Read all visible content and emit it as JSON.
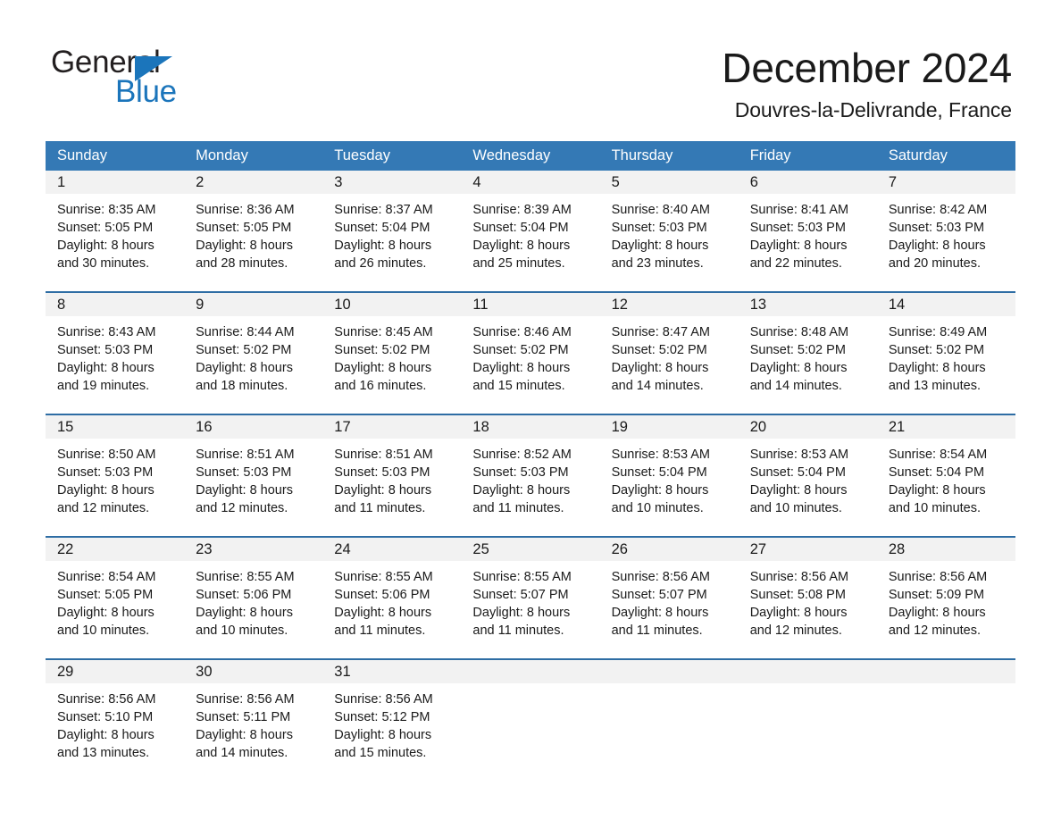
{
  "brand": {
    "word_one": "General",
    "word_two": "Blue",
    "triangle_color": "#1b75bb",
    "blue_color": "#1b75bb"
  },
  "header": {
    "month_title": "December 2024",
    "location": "Douvres-la-Delivrande, France"
  },
  "theme": {
    "header_band": "#3479b5",
    "week_divider": "#2e6da4",
    "date_band": "#f2f2f2",
    "page_background": "#ffffff",
    "text": "#1a1a1a"
  },
  "calendar": {
    "day_headers": [
      "Sunday",
      "Monday",
      "Tuesday",
      "Wednesday",
      "Thursday",
      "Friday",
      "Saturday"
    ],
    "weeks": [
      [
        {
          "day": "1",
          "sunrise": "Sunrise: 8:35 AM",
          "sunset": "Sunset: 5:05 PM",
          "daylight1": "Daylight: 8 hours",
          "daylight2": "and 30 minutes."
        },
        {
          "day": "2",
          "sunrise": "Sunrise: 8:36 AM",
          "sunset": "Sunset: 5:05 PM",
          "daylight1": "Daylight: 8 hours",
          "daylight2": "and 28 minutes."
        },
        {
          "day": "3",
          "sunrise": "Sunrise: 8:37 AM",
          "sunset": "Sunset: 5:04 PM",
          "daylight1": "Daylight: 8 hours",
          "daylight2": "and 26 minutes."
        },
        {
          "day": "4",
          "sunrise": "Sunrise: 8:39 AM",
          "sunset": "Sunset: 5:04 PM",
          "daylight1": "Daylight: 8 hours",
          "daylight2": "and 25 minutes."
        },
        {
          "day": "5",
          "sunrise": "Sunrise: 8:40 AM",
          "sunset": "Sunset: 5:03 PM",
          "daylight1": "Daylight: 8 hours",
          "daylight2": "and 23 minutes."
        },
        {
          "day": "6",
          "sunrise": "Sunrise: 8:41 AM",
          "sunset": "Sunset: 5:03 PM",
          "daylight1": "Daylight: 8 hours",
          "daylight2": "and 22 minutes."
        },
        {
          "day": "7",
          "sunrise": "Sunrise: 8:42 AM",
          "sunset": "Sunset: 5:03 PM",
          "daylight1": "Daylight: 8 hours",
          "daylight2": "and 20 minutes."
        }
      ],
      [
        {
          "day": "8",
          "sunrise": "Sunrise: 8:43 AM",
          "sunset": "Sunset: 5:03 PM",
          "daylight1": "Daylight: 8 hours",
          "daylight2": "and 19 minutes."
        },
        {
          "day": "9",
          "sunrise": "Sunrise: 8:44 AM",
          "sunset": "Sunset: 5:02 PM",
          "daylight1": "Daylight: 8 hours",
          "daylight2": "and 18 minutes."
        },
        {
          "day": "10",
          "sunrise": "Sunrise: 8:45 AM",
          "sunset": "Sunset: 5:02 PM",
          "daylight1": "Daylight: 8 hours",
          "daylight2": "and 16 minutes."
        },
        {
          "day": "11",
          "sunrise": "Sunrise: 8:46 AM",
          "sunset": "Sunset: 5:02 PM",
          "daylight1": "Daylight: 8 hours",
          "daylight2": "and 15 minutes."
        },
        {
          "day": "12",
          "sunrise": "Sunrise: 8:47 AM",
          "sunset": "Sunset: 5:02 PM",
          "daylight1": "Daylight: 8 hours",
          "daylight2": "and 14 minutes."
        },
        {
          "day": "13",
          "sunrise": "Sunrise: 8:48 AM",
          "sunset": "Sunset: 5:02 PM",
          "daylight1": "Daylight: 8 hours",
          "daylight2": "and 14 minutes."
        },
        {
          "day": "14",
          "sunrise": "Sunrise: 8:49 AM",
          "sunset": "Sunset: 5:02 PM",
          "daylight1": "Daylight: 8 hours",
          "daylight2": "and 13 minutes."
        }
      ],
      [
        {
          "day": "15",
          "sunrise": "Sunrise: 8:50 AM",
          "sunset": "Sunset: 5:03 PM",
          "daylight1": "Daylight: 8 hours",
          "daylight2": "and 12 minutes."
        },
        {
          "day": "16",
          "sunrise": "Sunrise: 8:51 AM",
          "sunset": "Sunset: 5:03 PM",
          "daylight1": "Daylight: 8 hours",
          "daylight2": "and 12 minutes."
        },
        {
          "day": "17",
          "sunrise": "Sunrise: 8:51 AM",
          "sunset": "Sunset: 5:03 PM",
          "daylight1": "Daylight: 8 hours",
          "daylight2": "and 11 minutes."
        },
        {
          "day": "18",
          "sunrise": "Sunrise: 8:52 AM",
          "sunset": "Sunset: 5:03 PM",
          "daylight1": "Daylight: 8 hours",
          "daylight2": "and 11 minutes."
        },
        {
          "day": "19",
          "sunrise": "Sunrise: 8:53 AM",
          "sunset": "Sunset: 5:04 PM",
          "daylight1": "Daylight: 8 hours",
          "daylight2": "and 10 minutes."
        },
        {
          "day": "20",
          "sunrise": "Sunrise: 8:53 AM",
          "sunset": "Sunset: 5:04 PM",
          "daylight1": "Daylight: 8 hours",
          "daylight2": "and 10 minutes."
        },
        {
          "day": "21",
          "sunrise": "Sunrise: 8:54 AM",
          "sunset": "Sunset: 5:04 PM",
          "daylight1": "Daylight: 8 hours",
          "daylight2": "and 10 minutes."
        }
      ],
      [
        {
          "day": "22",
          "sunrise": "Sunrise: 8:54 AM",
          "sunset": "Sunset: 5:05 PM",
          "daylight1": "Daylight: 8 hours",
          "daylight2": "and 10 minutes."
        },
        {
          "day": "23",
          "sunrise": "Sunrise: 8:55 AM",
          "sunset": "Sunset: 5:06 PM",
          "daylight1": "Daylight: 8 hours",
          "daylight2": "and 10 minutes."
        },
        {
          "day": "24",
          "sunrise": "Sunrise: 8:55 AM",
          "sunset": "Sunset: 5:06 PM",
          "daylight1": "Daylight: 8 hours",
          "daylight2": "and 11 minutes."
        },
        {
          "day": "25",
          "sunrise": "Sunrise: 8:55 AM",
          "sunset": "Sunset: 5:07 PM",
          "daylight1": "Daylight: 8 hours",
          "daylight2": "and 11 minutes."
        },
        {
          "day": "26",
          "sunrise": "Sunrise: 8:56 AM",
          "sunset": "Sunset: 5:07 PM",
          "daylight1": "Daylight: 8 hours",
          "daylight2": "and 11 minutes."
        },
        {
          "day": "27",
          "sunrise": "Sunrise: 8:56 AM",
          "sunset": "Sunset: 5:08 PM",
          "daylight1": "Daylight: 8 hours",
          "daylight2": "and 12 minutes."
        },
        {
          "day": "28",
          "sunrise": "Sunrise: 8:56 AM",
          "sunset": "Sunset: 5:09 PM",
          "daylight1": "Daylight: 8 hours",
          "daylight2": "and 12 minutes."
        }
      ],
      [
        {
          "day": "29",
          "sunrise": "Sunrise: 8:56 AM",
          "sunset": "Sunset: 5:10 PM",
          "daylight1": "Daylight: 8 hours",
          "daylight2": "and 13 minutes."
        },
        {
          "day": "30",
          "sunrise": "Sunrise: 8:56 AM",
          "sunset": "Sunset: 5:11 PM",
          "daylight1": "Daylight: 8 hours",
          "daylight2": "and 14 minutes."
        },
        {
          "day": "31",
          "sunrise": "Sunrise: 8:56 AM",
          "sunset": "Sunset: 5:12 PM",
          "daylight1": "Daylight: 8 hours",
          "daylight2": "and 15 minutes."
        },
        {
          "day": "",
          "sunrise": "",
          "sunset": "",
          "daylight1": "",
          "daylight2": "",
          "empty": true
        },
        {
          "day": "",
          "sunrise": "",
          "sunset": "",
          "daylight1": "",
          "daylight2": "",
          "empty": true
        },
        {
          "day": "",
          "sunrise": "",
          "sunset": "",
          "daylight1": "",
          "daylight2": "",
          "empty": true
        },
        {
          "day": "",
          "sunrise": "",
          "sunset": "",
          "daylight1": "",
          "daylight2": "",
          "empty": true
        }
      ]
    ]
  }
}
